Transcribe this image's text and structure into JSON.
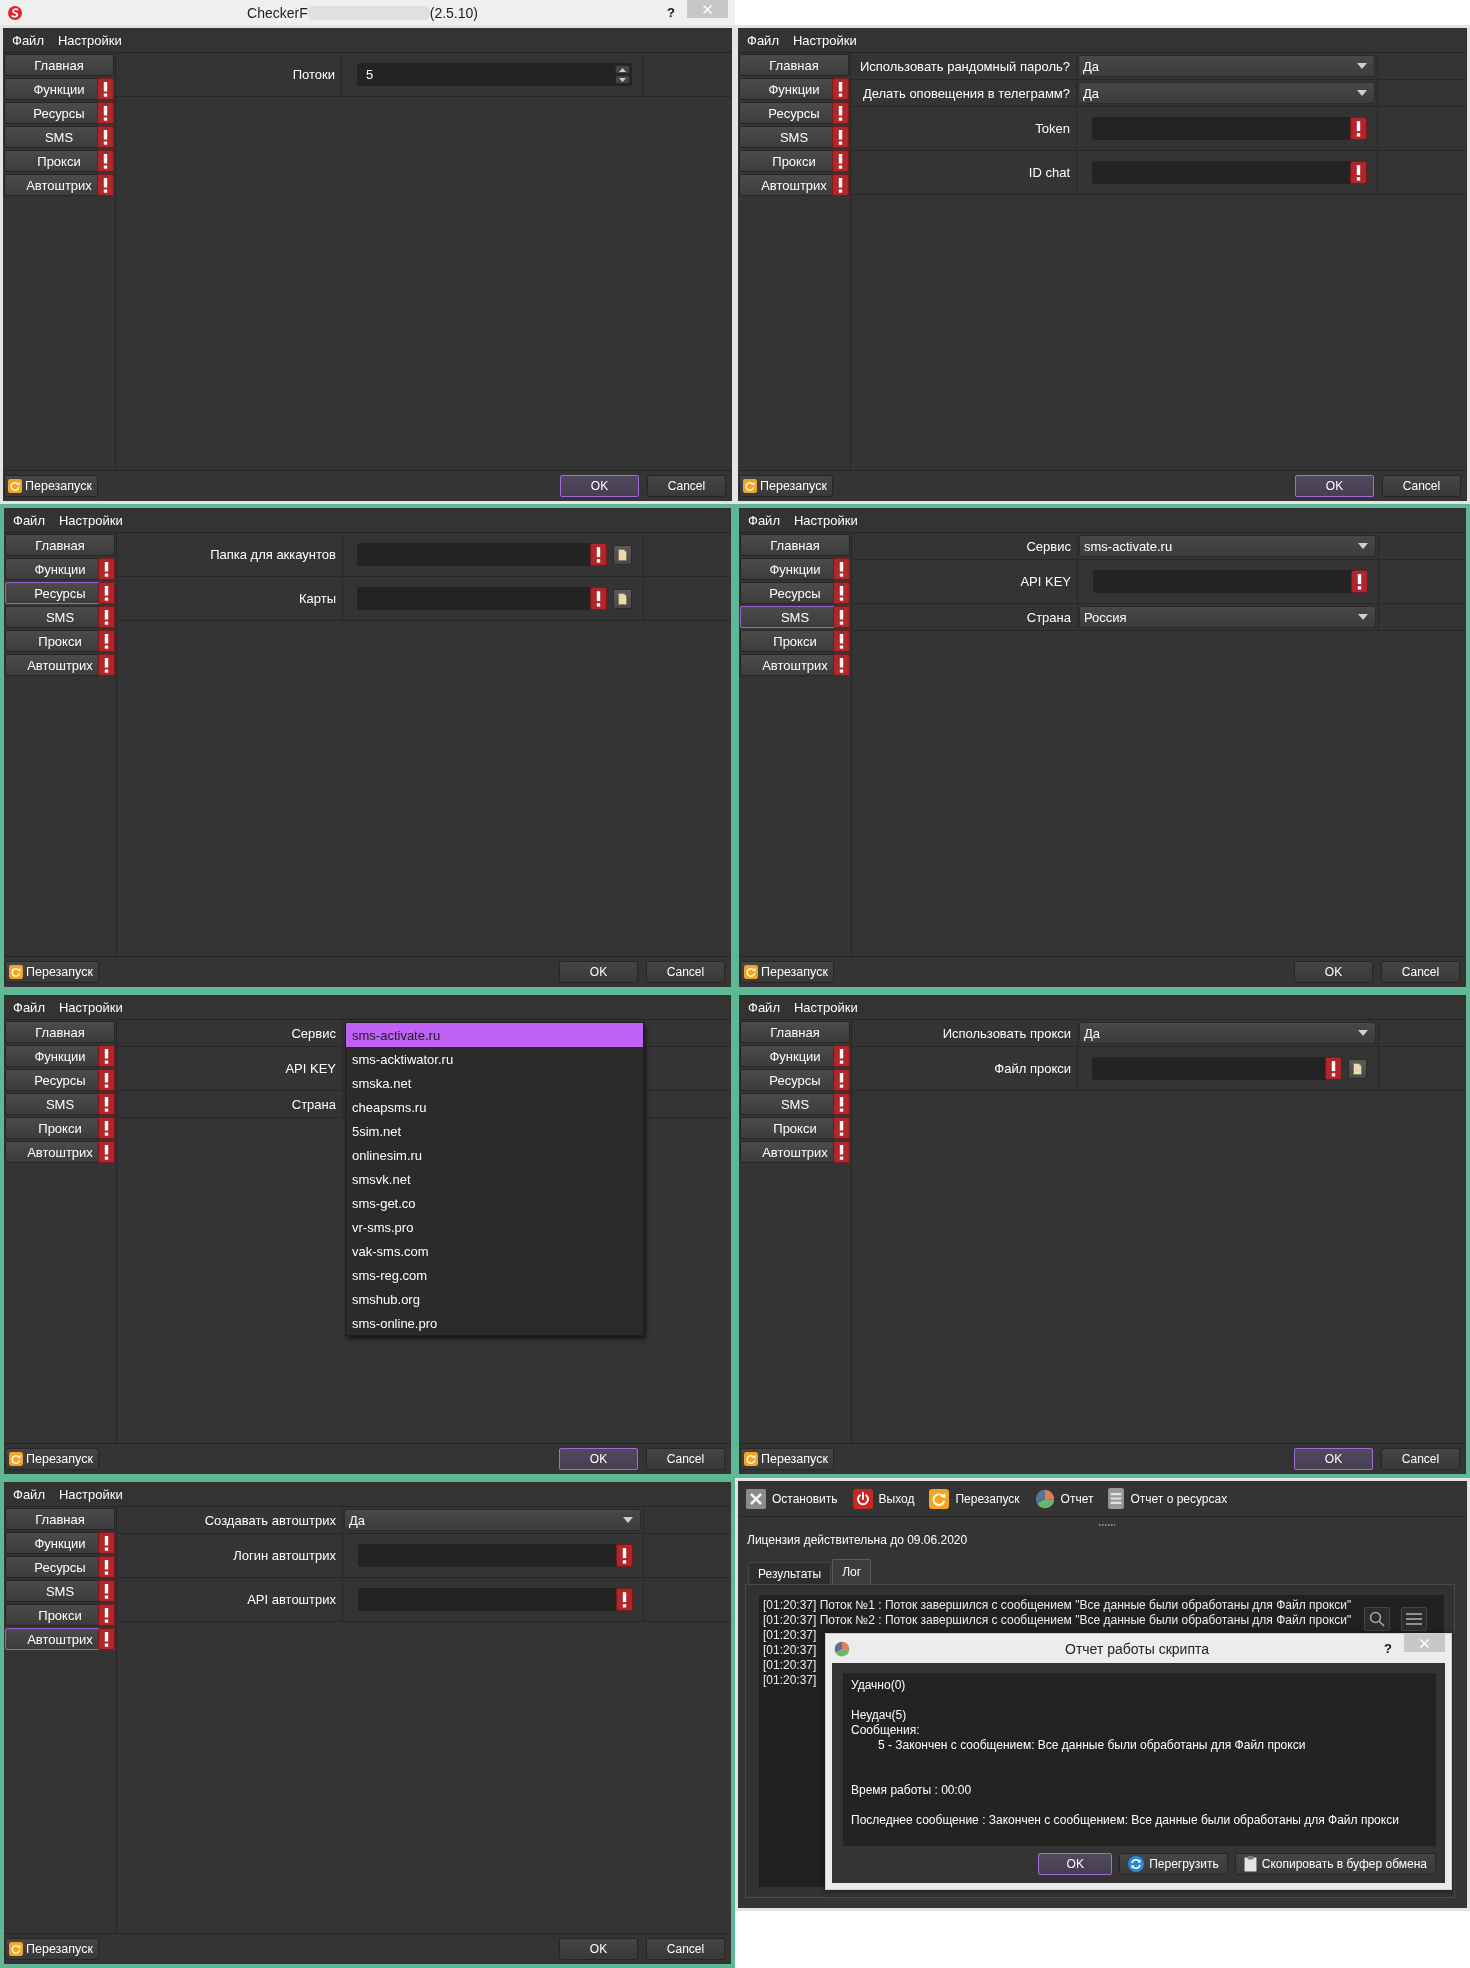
{
  "panels": [
    {
      "kind": "settings",
      "highlighted": false,
      "title_bar": {
        "title": "CheckerF",
        "version": "(2.5.10)",
        "help": "?"
      },
      "menu": [
        "Файл",
        "Настройки"
      ],
      "sidebar": [
        {
          "label": "Главная",
          "warning": false,
          "focused": false
        },
        {
          "label": "Функции",
          "warning": true,
          "focused": false
        },
        {
          "label": "Ресурсы",
          "warning": true,
          "focused": false
        },
        {
          "label": "SMS",
          "warning": true,
          "focused": false
        },
        {
          "label": "Прокси",
          "warning": true,
          "focused": false
        },
        {
          "label": "Автоштрих",
          "warning": true,
          "focused": false
        }
      ],
      "form": [
        {
          "kind": "spin",
          "label": "Потоки",
          "value": "5"
        }
      ],
      "restart": "Перезапуск",
      "ok": {
        "label": "OK",
        "focused": true
      },
      "cancel": "Cancel"
    },
    {
      "kind": "settings",
      "highlighted": false,
      "menu": [
        "Файл",
        "Настройки"
      ],
      "sidebar": [
        {
          "label": "Главная",
          "warning": false,
          "focused": false
        },
        {
          "label": "Функции",
          "warning": true,
          "focused": false
        },
        {
          "label": "Ресурсы",
          "warning": true,
          "focused": false
        },
        {
          "label": "SMS",
          "warning": true,
          "focused": false
        },
        {
          "label": "Прокси",
          "warning": true,
          "focused": false
        },
        {
          "label": "Автоштрих",
          "warning": true,
          "focused": false
        }
      ],
      "form": [
        {
          "kind": "select",
          "label": "Использовать рандомный пароль?",
          "value": "Да"
        },
        {
          "kind": "select",
          "label": "Делать оповещения в телеграмм?",
          "value": "Да"
        },
        {
          "kind": "text",
          "label": "Token",
          "warning": true
        },
        {
          "kind": "text",
          "label": "ID chat",
          "warning": true
        }
      ],
      "restart": "Перезапуск",
      "ok": {
        "label": "OK",
        "focused": true
      },
      "cancel": "Cancel"
    },
    {
      "kind": "settings",
      "highlighted": true,
      "menu": [
        "Файл",
        "Настройки"
      ],
      "sidebar": [
        {
          "label": "Главная",
          "warning": false,
          "focused": false
        },
        {
          "label": "Функции",
          "warning": true,
          "focused": false
        },
        {
          "label": "Ресурсы",
          "warning": true,
          "focused": true
        },
        {
          "label": "SMS",
          "warning": true,
          "focused": false
        },
        {
          "label": "Прокси",
          "warning": true,
          "focused": false
        },
        {
          "label": "Автоштрих",
          "warning": true,
          "focused": false
        }
      ],
      "form": [
        {
          "kind": "file",
          "label": "Папка для аккаунтов",
          "warning": true
        },
        {
          "kind": "file",
          "label": "Карты",
          "warning": true
        }
      ],
      "restart": "Перезапуск",
      "ok": {
        "label": "OK",
        "focused": false
      },
      "cancel": "Cancel"
    },
    {
      "kind": "settings",
      "highlighted": true,
      "menu": [
        "Файл",
        "Настройки"
      ],
      "sidebar": [
        {
          "label": "Главная",
          "warning": false,
          "focused": false
        },
        {
          "label": "Функции",
          "warning": true,
          "focused": false
        },
        {
          "label": "Ресурсы",
          "warning": true,
          "focused": false
        },
        {
          "label": "SMS",
          "warning": true,
          "focused": true
        },
        {
          "label": "Прокси",
          "warning": true,
          "focused": false
        },
        {
          "label": "Автоштрих",
          "warning": true,
          "focused": false
        }
      ],
      "form": [
        {
          "kind": "select",
          "label": "Сервис",
          "value": "sms-activate.ru"
        },
        {
          "kind": "text",
          "label": "API KEY",
          "warning": true
        },
        {
          "kind": "select",
          "label": "Страна",
          "value": "Россия"
        }
      ],
      "restart": "Перезапуск",
      "ok": {
        "label": "OK",
        "focused": false
      },
      "cancel": "Cancel"
    },
    {
      "kind": "settings",
      "highlighted": true,
      "menu": [
        "Файл",
        "Настройки"
      ],
      "sidebar": [
        {
          "label": "Главная",
          "warning": false,
          "focused": false
        },
        {
          "label": "Функции",
          "warning": true,
          "focused": false
        },
        {
          "label": "Ресурсы",
          "warning": true,
          "focused": false
        },
        {
          "label": "SMS",
          "warning": true,
          "focused": false
        },
        {
          "label": "Прокси",
          "warning": true,
          "focused": false
        },
        {
          "label": "Автоштрих",
          "warning": true,
          "focused": false
        }
      ],
      "form": [
        {
          "kind": "select",
          "label": "Сервис"
        },
        {
          "kind": "text",
          "label": "API KEY"
        },
        {
          "kind": "select",
          "label": "Страна"
        }
      ],
      "dropdown": {
        "options": [
          {
            "label": "sms-activate.ru",
            "selected": true
          },
          {
            "label": "sms-acktiwator.ru",
            "selected": false
          },
          {
            "label": "smska.net",
            "selected": false
          },
          {
            "label": "cheapsms.ru",
            "selected": false
          },
          {
            "label": "5sim.net",
            "selected": false
          },
          {
            "label": "onlinesim.ru",
            "selected": false
          },
          {
            "label": "smsvk.net",
            "selected": false
          },
          {
            "label": "sms-get.co",
            "selected": false
          },
          {
            "label": "vr-sms.pro",
            "selected": false
          },
          {
            "label": "vak-sms.com",
            "selected": false
          },
          {
            "label": "sms-reg.com",
            "selected": false
          },
          {
            "label": "smshub.org",
            "selected": false
          },
          {
            "label": "sms-online.pro",
            "selected": false
          }
        ]
      },
      "restart": "Перезапуск",
      "ok": {
        "label": "OK",
        "focused": true
      },
      "cancel": "Cancel"
    },
    {
      "kind": "settings",
      "highlighted": true,
      "menu": [
        "Файл",
        "Настройки"
      ],
      "sidebar": [
        {
          "label": "Главная",
          "warning": false,
          "focused": false
        },
        {
          "label": "Функции",
          "warning": true,
          "focused": false
        },
        {
          "label": "Ресурсы",
          "warning": true,
          "focused": false
        },
        {
          "label": "SMS",
          "warning": true,
          "focused": false
        },
        {
          "label": "Прокси",
          "warning": true,
          "focused": false
        },
        {
          "label": "Автоштрих",
          "warning": true,
          "focused": false
        }
      ],
      "form": [
        {
          "kind": "select",
          "label": "Использовать прокси",
          "value": "Да"
        },
        {
          "kind": "file",
          "label": "Файл прокси",
          "warning": true
        }
      ],
      "restart": "Перезапуск",
      "ok": {
        "label": "OK",
        "focused": true
      },
      "cancel": "Cancel"
    },
    {
      "kind": "settings",
      "highlighted": true,
      "menu": [
        "Файл",
        "Настройки"
      ],
      "sidebar": [
        {
          "label": "Главная",
          "warning": false,
          "focused": false
        },
        {
          "label": "Функции",
          "warning": true,
          "focused": false
        },
        {
          "label": "Ресурсы",
          "warning": true,
          "focused": false
        },
        {
          "label": "SMS",
          "warning": true,
          "focused": false
        },
        {
          "label": "Прокси",
          "warning": true,
          "focused": false
        },
        {
          "label": "Автоштрих",
          "warning": true,
          "focused": true
        }
      ],
      "form": [
        {
          "kind": "select",
          "label": "Создавать автоштрих",
          "value": "Да"
        },
        {
          "kind": "text",
          "label": "Логин автоштрих",
          "warning": true
        },
        {
          "kind": "text",
          "label": "API автоштрих",
          "warning": true
        }
      ],
      "restart": "Перезапуск",
      "ok": {
        "label": "OK",
        "focused": false
      },
      "cancel": "Cancel"
    },
    {
      "kind": "main",
      "highlighted": false,
      "toolbar": [
        {
          "kind": "stop",
          "label": "Остановить"
        },
        {
          "kind": "exit",
          "label": "Выход"
        },
        {
          "kind": "restart",
          "label": "Перезапуск"
        },
        {
          "kind": "report",
          "label": "Отчет"
        },
        {
          "kind": "resources",
          "label": "Отчет о ресурсах"
        }
      ],
      "license": "Лицензия действительна до 09.06.2020",
      "tabs": [
        {
          "label": "Результаты",
          "selected": false
        },
        {
          "label": "Лог",
          "selected": true
        }
      ],
      "log": [
        "[01:20:37] Поток №1 : Поток завершился с сообщением \"Все данные были обработаны для Файл прокси\"",
        "[01:20:37] Поток №2 : Поток завершился с сообщением \"Все данные были обработаны для Файл прокси\"",
        "[01:20:37]",
        "[01:20:37]",
        "[01:20:37]",
        "[01:20:37]"
      ],
      "dialog": {
        "title": "Отчет работы скрипта",
        "help": "?",
        "report": [
          {
            "lines": [
              {
                "text": "Удачно(0)"
              }
            ]
          },
          {
            "lines": [
              {
                "text": "Неудач(5)"
              },
              {
                "text": "Сообщения:",
                "children": [
                  {
                    "text": "5 - Закончен с сообщением: Все данные были обработаны для Файл прокси"
                  }
                ]
              }
            ]
          },
          {
            "lines": [
              {
                "text": "Время работы : 00:00"
              }
            ]
          },
          {
            "lines": [
              {
                "text": "Последнее сообщение : Закончен с сообщением: Все данные были обработаны для Файл прокси"
              }
            ]
          }
        ],
        "buttons": [
          {
            "kind": "ok",
            "label": "OK",
            "focused": true
          },
          {
            "kind": "reload",
            "label": "Перегрузить",
            "focused": false
          },
          {
            "kind": "copy",
            "label": "Скопировать в буфер обмена",
            "focused": false
          }
        ]
      }
    }
  ]
}
